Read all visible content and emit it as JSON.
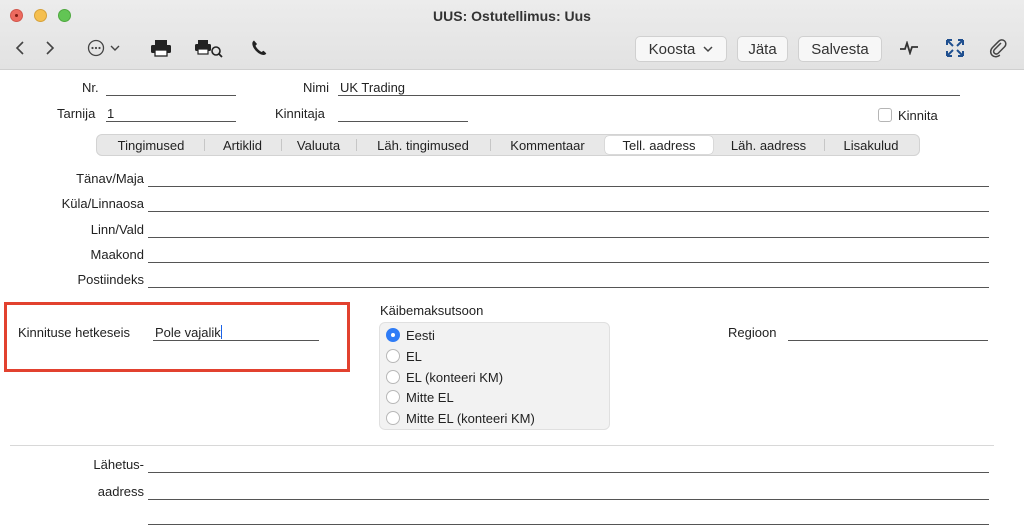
{
  "window": {
    "title": "UUS: Ostutellimus: Uus"
  },
  "toolbar": {
    "back_icon": "chevron-left-icon",
    "forward_icon": "chevron-right-icon",
    "more_icon": "ellipsis-circle-icon",
    "print_icon": "printer-icon",
    "preview_icon": "print-preview-icon",
    "phone_icon": "phone-icon",
    "koosta_label": "Koosta",
    "jata_label": "Jäta",
    "salvesta_label": "Salvesta",
    "activity_icon": "activity-icon",
    "expand_icon": "expand-icon",
    "attach_icon": "paperclip-icon"
  },
  "header": {
    "nr_label": "Nr.",
    "nr_value": "",
    "nimi_label": "Nimi",
    "nimi_value": "UK Trading",
    "tarnija_label": "Tarnija",
    "tarnija_value": "1",
    "kinnitaja_label": "Kinnitaja",
    "kinnitaja_value": "",
    "kinnita_label": "Kinnita",
    "kinnita_checked": false
  },
  "tabs": [
    {
      "label": "Tingimused",
      "active": false
    },
    {
      "label": "Artiklid",
      "active": false
    },
    {
      "label": "Valuuta",
      "active": false
    },
    {
      "label": "Läh. tingimused",
      "active": false
    },
    {
      "label": "Kommentaar",
      "active": false
    },
    {
      "label": "Tell. aadress",
      "active": true
    },
    {
      "label": "Läh. aadress",
      "active": false
    },
    {
      "label": "Lisakulud",
      "active": false
    }
  ],
  "address": {
    "street_label": "Tänav/Maja",
    "street_value": "",
    "village_label": "Küla/Linnaosa",
    "village_value": "",
    "city_label": "Linn/Vald",
    "city_value": "",
    "county_label": "Maakond",
    "county_value": "",
    "postal_label": "Postiindeks",
    "postal_value": ""
  },
  "confirmation": {
    "label": "Kinnituse hetkeseis",
    "value": "Pole vajalik"
  },
  "vat_zone": {
    "title": "Käibemaksutsoon",
    "options": [
      {
        "label": "Eesti",
        "selected": true
      },
      {
        "label": "EL",
        "selected": false
      },
      {
        "label": "EL (konteeri KM)",
        "selected": false
      },
      {
        "label": "Mitte EL",
        "selected": false
      },
      {
        "label": "Mitte EL (konteeri KM)",
        "selected": false
      }
    ]
  },
  "region": {
    "label": "Regioon",
    "value": ""
  },
  "shipping": {
    "label_line1": "Lähetus-",
    "label_line2": "aadress",
    "line1": "",
    "line2": "",
    "line3": ""
  },
  "colors": {
    "highlight": "#e2412f",
    "radio_accent": "#2f7cf6",
    "caret": "#1a62e8"
  }
}
